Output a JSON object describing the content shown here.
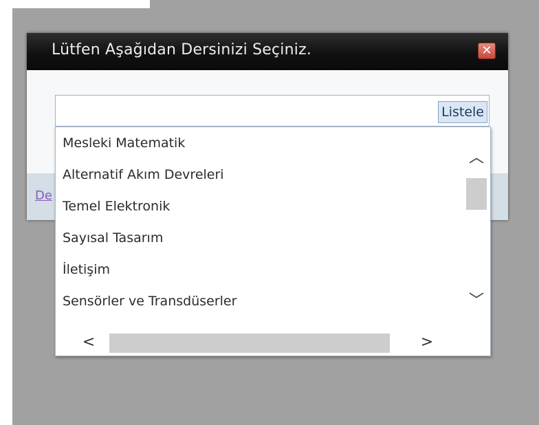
{
  "dialog": {
    "title": "Lütfen Aşağıdan Dersinizi Seçiniz.",
    "close_glyph": "✕",
    "footer_link": "De"
  },
  "search": {
    "value": "",
    "placeholder": "",
    "button_label": "Listele"
  },
  "courses": [
    "Mesleki Matematik",
    "Alternatif Akım Devreleri",
    "Temel Elektronik",
    "Sayısal Tasarım",
    "İletişim",
    "Sensörler ve Transdüserler"
  ],
  "scrollbars": {
    "up_glyph": "︿",
    "down_glyph": "﹀",
    "left_glyph": "<",
    "right_glyph": ">"
  },
  "colors": {
    "titlebar": "#111111",
    "close_button": "#c8473b",
    "link": "#8a5bb7",
    "backdrop": "#a1a1a1"
  }
}
